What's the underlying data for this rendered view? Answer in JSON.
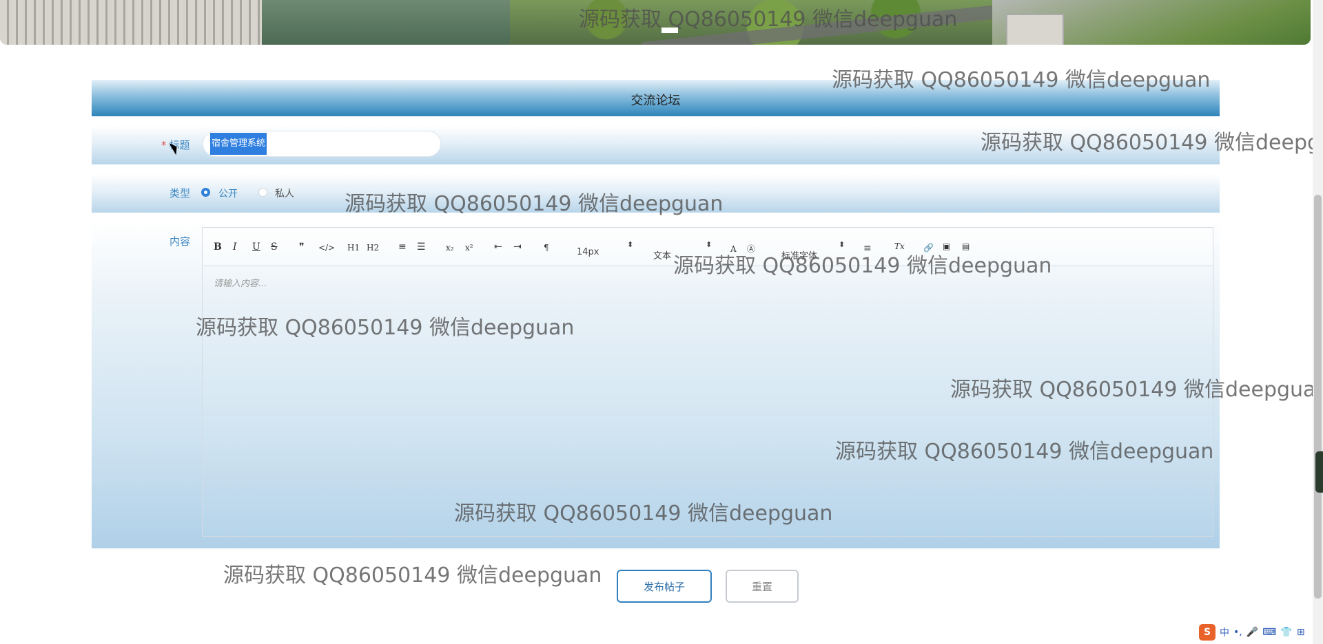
{
  "page": {
    "section_title": "交流论坛",
    "watermark_text": "源码获取 QQ86050149 微信deepguan"
  },
  "form": {
    "title_label": "标题",
    "title_value": "宿舍管理系统",
    "type_label": "类型",
    "type_options": [
      "公开",
      "私人"
    ],
    "type_selected": "公开",
    "content_label": "内容"
  },
  "editor": {
    "toolbar": {
      "bold": "B",
      "italic": "I",
      "underline": "U",
      "strike": "S",
      "blockquote": "❞",
      "code": "</>",
      "h1": "H1",
      "h2": "H2",
      "ordered_list": "≡",
      "bullet_list": "☰",
      "subscript": "x₂",
      "superscript": "x²",
      "outdent": "⇤",
      "indent": "⇥",
      "direction": "¶",
      "size": "14px",
      "header": "文本",
      "font": "标准字体",
      "align": "≡",
      "clean": "Tx"
    },
    "placeholder": "请输入内容..."
  },
  "buttons": {
    "publish": "发布帖子",
    "reset": "重置"
  },
  "ime": {
    "logo": "S",
    "mode": "中"
  }
}
